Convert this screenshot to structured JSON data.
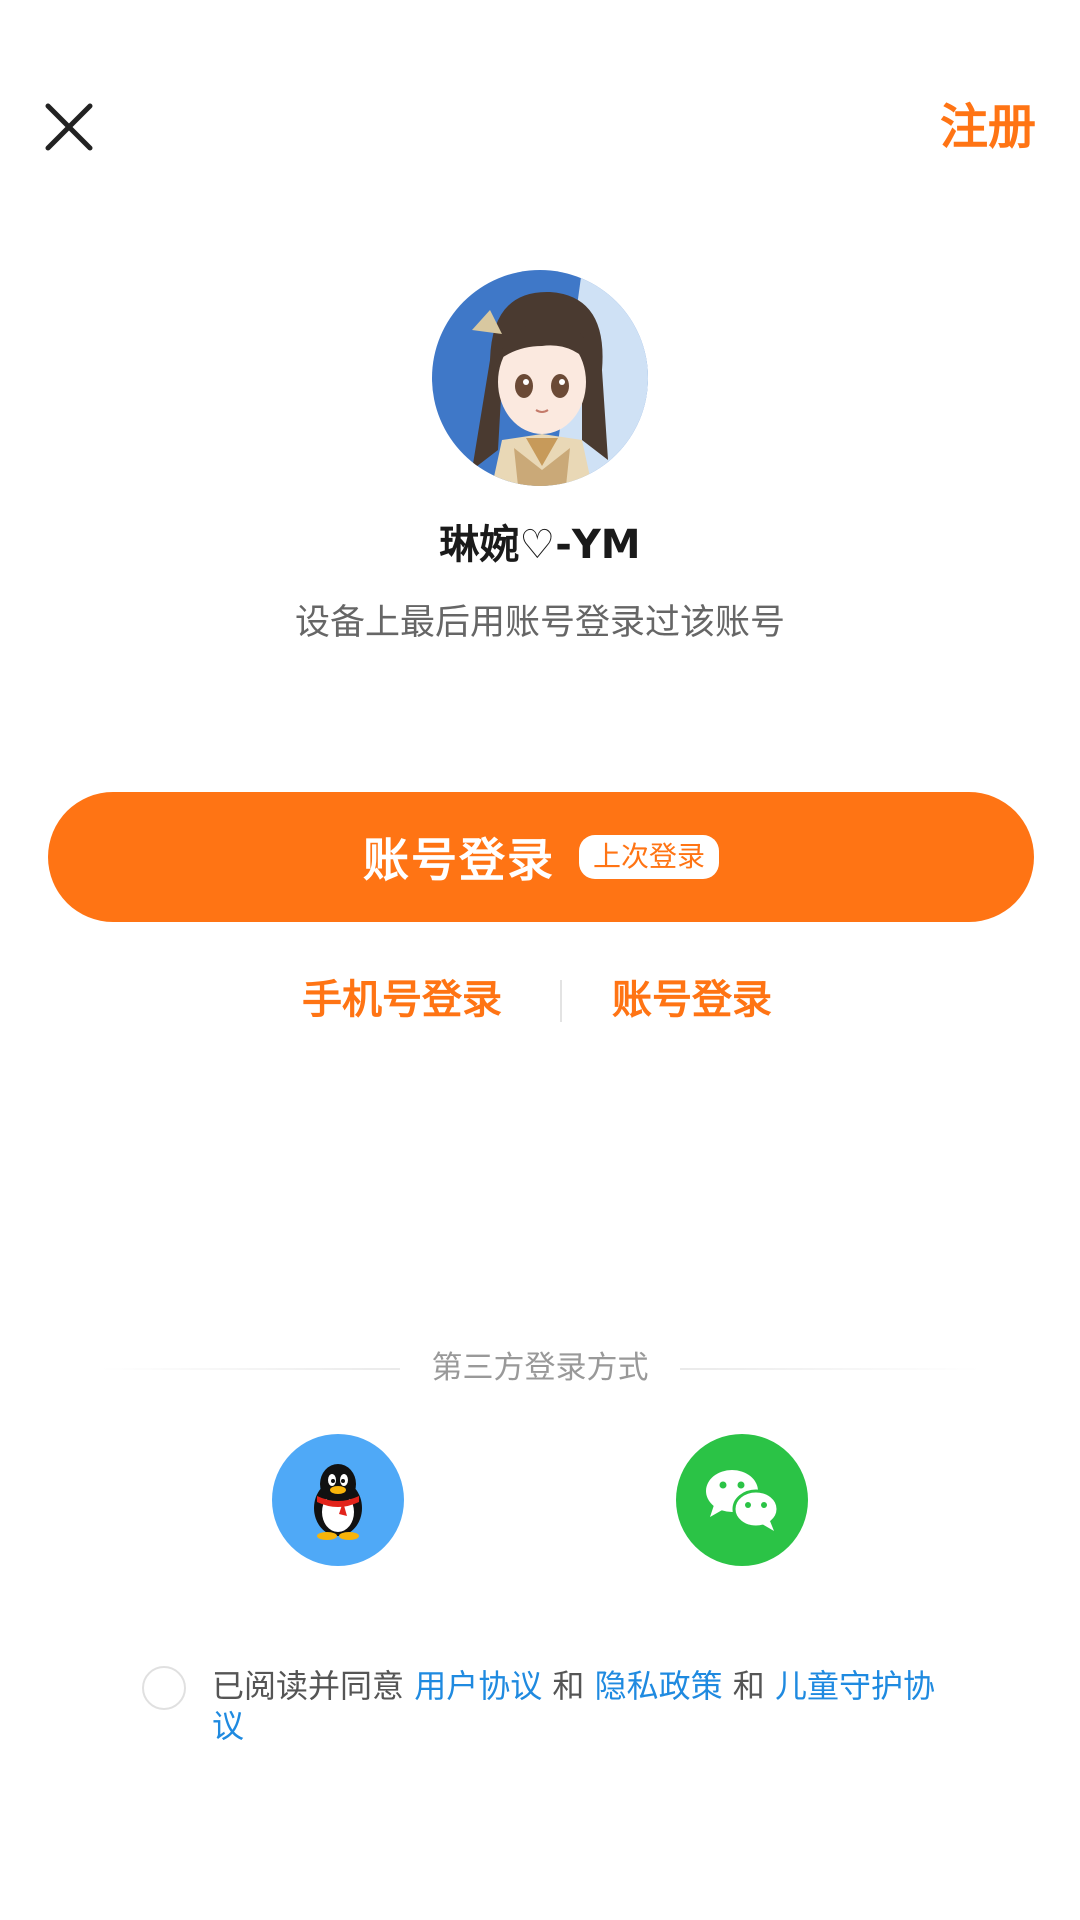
{
  "header": {
    "close_icon": "close-icon",
    "register_label": "注册"
  },
  "profile": {
    "avatar_icon": "anime-girl-avatar",
    "username": "琳婉♡-YM",
    "hint": "设备上最后用账号登录过该账号"
  },
  "primary_login": {
    "label": "账号登录",
    "badge": "上次登录"
  },
  "alt_login": {
    "phone_label": "手机号登录",
    "account_label": "账号登录"
  },
  "third_party": {
    "label": "第三方登录方式",
    "qq_icon": "qq-penguin-icon",
    "wechat_icon": "wechat-icon"
  },
  "agreement": {
    "prefix": "已阅读并同意",
    "user_agreement": "用户协议",
    "and1": "和",
    "privacy_policy": "隐私政策",
    "and2": "和",
    "child_protection": "儿童守护协议"
  },
  "colors": {
    "accent": "#ff7414",
    "link": "#1f8ae0",
    "qq_bg": "#4fa9f7",
    "wechat_bg": "#2bc346"
  }
}
